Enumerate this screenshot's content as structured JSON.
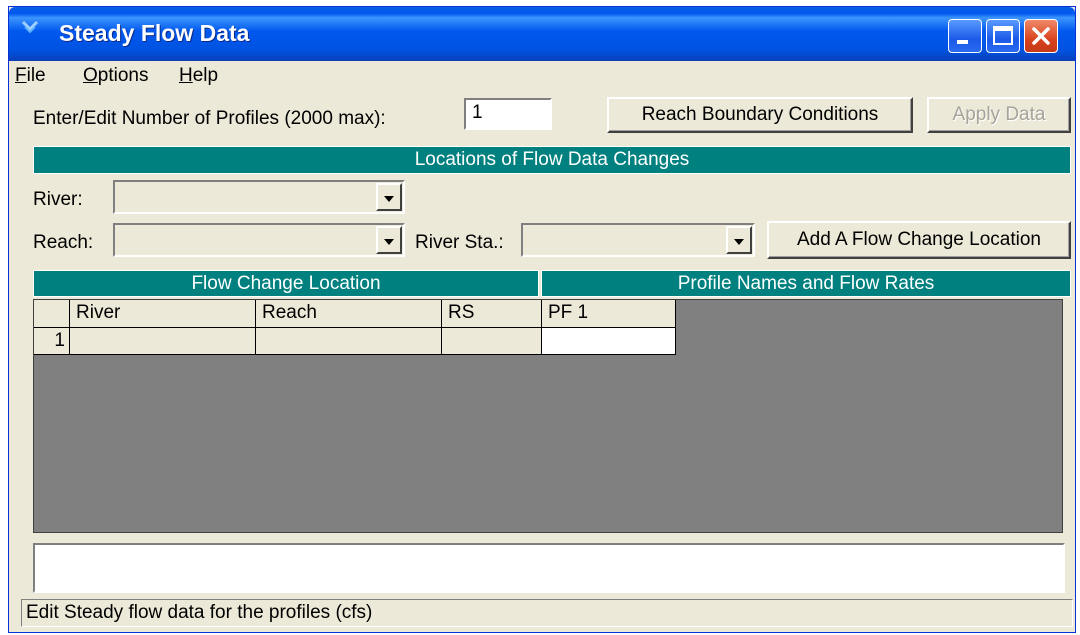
{
  "window": {
    "title": "Steady Flow Data",
    "icon": "app-icon",
    "controls": {
      "minimize": "minimize-icon",
      "maximize": "maximize-icon",
      "close": "close-icon"
    }
  },
  "menu": {
    "file": {
      "first": "F",
      "rest": "ile"
    },
    "options": {
      "first": "O",
      "rest": "ptions"
    },
    "help": {
      "first": "H",
      "rest": "elp"
    }
  },
  "profiles": {
    "label": "Enter/Edit Number of Profiles (2000 max):",
    "value": "1"
  },
  "buttons": {
    "reach_boundary": "Reach Boundary Conditions",
    "apply_data": "Apply Data",
    "add_flow_change": "Add A Flow Change Location"
  },
  "locations": {
    "header": "Locations of Flow Data Changes",
    "river_label": "River:",
    "river_value": "",
    "reach_label": "Reach:",
    "reach_value": "",
    "river_sta_label": "River Sta.:",
    "river_sta_value": ""
  },
  "table": {
    "left_header": "Flow Change Location",
    "right_header": "Profile Names and Flow Rates",
    "columns": [
      "River",
      "Reach",
      "RS",
      "PF 1"
    ],
    "rows": [
      {
        "index": "1",
        "river": "",
        "reach": "",
        "rs": "",
        "pf1": ""
      }
    ]
  },
  "message": "",
  "status": "Edit Steady flow data for the profiles (cfs)",
  "colors": {
    "band": "#00807f",
    "grid_background": "#808080",
    "window_face": "#ece9d8"
  }
}
